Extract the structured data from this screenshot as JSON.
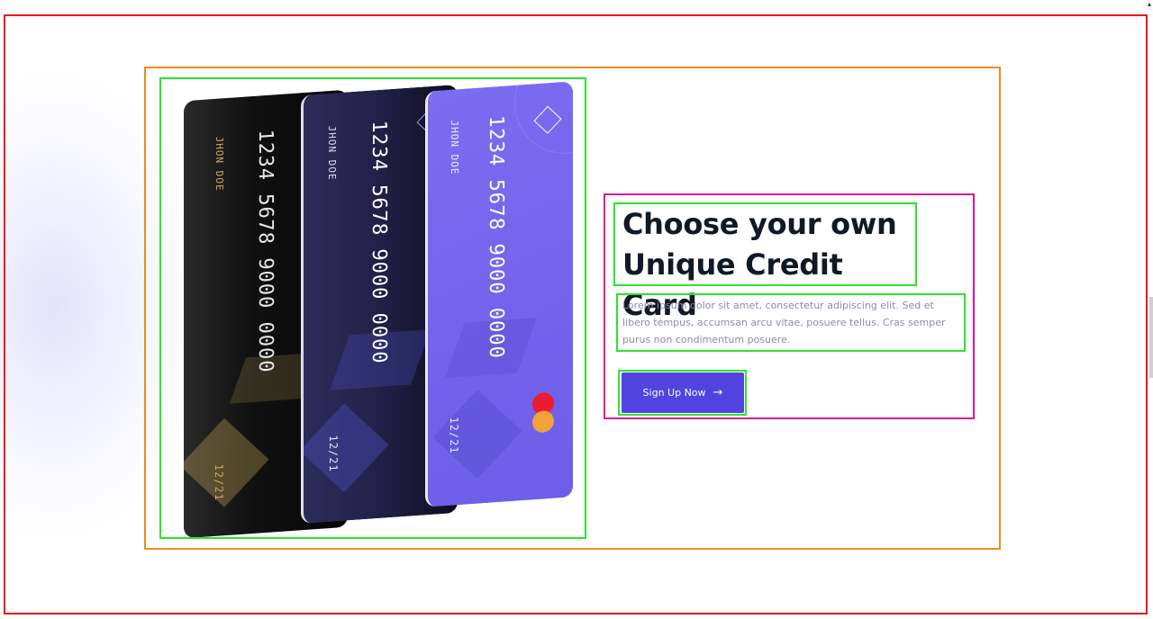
{
  "hero": {
    "heading_line1": "Choose your own",
    "heading_line2": "Unique Credit Card",
    "description": "Lorem ipsum dolor sit amet, consectetur adipiscing elit. Sed et libero tempus, accumsan arcu vitae, posuere tellus. Cras semper purus non condimentum posuere.",
    "cta_label": "Sign Up Now",
    "cta_icon": "arrow-right-icon"
  },
  "cards": {
    "number": "1234 5678 9000 0000",
    "holder": "JHON DOE",
    "expiry": "12/21"
  },
  "colors": {
    "accent": "#5243e0",
    "heading": "#101a26",
    "body_text": "#8a8ca8",
    "card_gold": "#c9a85a",
    "card_purple": "#6d5de8",
    "card_navy": "#22224a"
  }
}
